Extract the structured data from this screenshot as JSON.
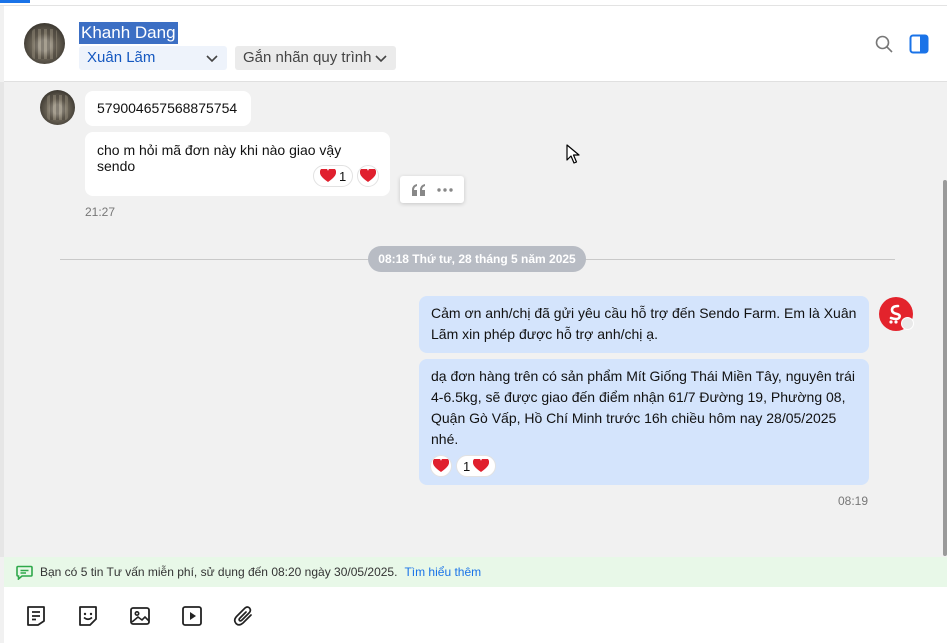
{
  "header": {
    "contact_name": "Khanh Dang",
    "agent_select": "Xuân Lãm",
    "label_select": "Gắn nhãn quy trình"
  },
  "conversation": {
    "incoming": [
      {
        "text": "579004657568875754"
      },
      {
        "text": "cho m hỏi mã đơn này khi nào giao vậy sendo",
        "reaction_count": "1"
      }
    ],
    "incoming_time": "21:27",
    "date_separator": "08:18 Thứ tư, 28 tháng 5 năm 2025",
    "outgoing": [
      {
        "text": "Cảm ơn anh/chị đã gửi yêu cầu hỗ trợ đến Sendo Farm. Em là Xuân Lãm xin phép được hỗ trợ anh/chị ạ."
      },
      {
        "text": "dạ đơn hàng trên có sản phẩm Mít Giống Thái Miền Tây, nguyên trái 4-6.5kg, sẽ được giao đến điểm nhận 61/7 Đường 19, Phường 08, Quận Gò Vấp, Hồ Chí Minh trước 16h chiều hôm nay 28/05/2025 nhé.",
        "reaction_count": "1"
      }
    ],
    "outgoing_time": "08:19"
  },
  "notice": {
    "text": "Bạn có 5 tin Tư vấn miễn phí, sử dụng đến 08:20 ngày 30/05/2025.",
    "link": "Tìm hiểu thêm"
  },
  "colors": {
    "accent": "#1a73e8",
    "outgoing_bubble": "#d4e4fc",
    "brand_red": "#e3232c",
    "notice_bg": "#e8f8e8"
  },
  "icons": [
    "search-icon",
    "side-panel-icon",
    "chevron-down-icon",
    "quote-icon",
    "more-icon",
    "heart-icon",
    "chat-bubble-icon",
    "quick-reply-icon",
    "sticker-icon",
    "image-icon",
    "video-icon",
    "attachment-icon"
  ]
}
